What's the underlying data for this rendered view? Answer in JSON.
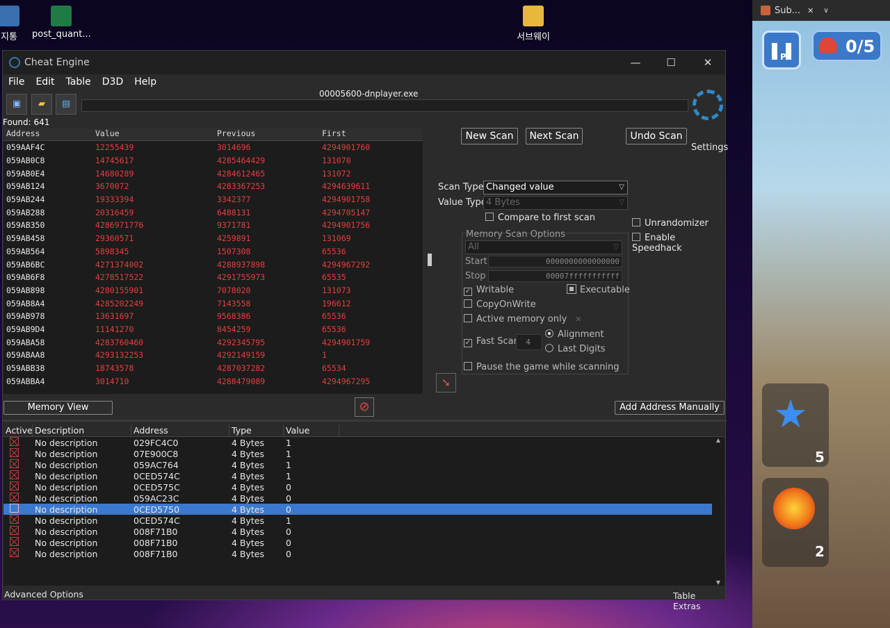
{
  "desktop": {
    "icons": [
      {
        "label": "지통"
      },
      {
        "label": "post_quant..."
      },
      {
        "label": "서브웨이"
      }
    ]
  },
  "window": {
    "title": "Cheat Engine",
    "process_title": "00005600-dnplayer.exe",
    "min": "—",
    "max": "☐",
    "close": "✕"
  },
  "menu": [
    "File",
    "Edit",
    "Table",
    "D3D",
    "Help"
  ],
  "found": "Found: 641",
  "scan_list": {
    "headers": [
      "Address",
      "Value",
      "Previous",
      "First"
    ],
    "rows": [
      [
        "059AAF4C",
        "12255439",
        "3014696",
        "4294901760"
      ],
      [
        "059AB0C8",
        "14745617",
        "4285464429",
        "131070"
      ],
      [
        "059AB0E4",
        "14680289",
        "4284612465",
        "131072"
      ],
      [
        "059AB124",
        "3670072",
        "4283367253",
        "4294639611"
      ],
      [
        "059AB244",
        "19333394",
        "3342377",
        "4294901758"
      ],
      [
        "059AB288",
        "20316459",
        "6488131",
        "4294705147"
      ],
      [
        "059AB350",
        "4286971776",
        "9371781",
        "4294901756"
      ],
      [
        "059AB458",
        "29360571",
        "4259891",
        "131069"
      ],
      [
        "059AB564",
        "5898345",
        "1507308",
        "65536"
      ],
      [
        "059AB6BC",
        "4271374002",
        "4288937898",
        "4294967292"
      ],
      [
        "059AB6F8",
        "4278517522",
        "4291755973",
        "65535"
      ],
      [
        "059AB898",
        "4280155901",
        "7078020",
        "131073"
      ],
      [
        "059AB8A4",
        "4285202249",
        "7143558",
        "196612"
      ],
      [
        "059AB978",
        "13631697",
        "9568386",
        "65536"
      ],
      [
        "059AB9D4",
        "11141270",
        "8454259",
        "65536"
      ],
      [
        "059ABA58",
        "4283760460",
        "4292345795",
        "4294901759"
      ],
      [
        "059ABAA8",
        "4293132253",
        "4292149159",
        "1"
      ],
      [
        "059ABB38",
        "18743578",
        "4287037282",
        "65534"
      ],
      [
        "059ABBA4",
        "3014710",
        "4288479089",
        "4294967295"
      ]
    ]
  },
  "buttons": {
    "new_scan": "New Scan",
    "next_scan": "Next Scan",
    "undo_scan": "Undo Scan",
    "settings": "Settings",
    "memory_view": "Memory View",
    "add_address": "Add Address Manually"
  },
  "scan": {
    "scan_type_label": "Scan Type",
    "scan_type_value": "Changed value",
    "value_type_label": "Value Type",
    "value_type_value": "4 Bytes",
    "compare_first": "Compare to first scan",
    "unrandomizer": "Unrandomizer",
    "speedhack": "Enable Speedhack"
  },
  "memory_opts": {
    "title": "Memory Scan Options",
    "region": "All",
    "start_label": "Start",
    "start_value": "0000000000000000",
    "stop_label": "Stop",
    "stop_value": "00007fffffffffff",
    "writable": "Writable",
    "executable": "Executable",
    "copyonwrite": "CopyOnWrite",
    "active_only": "Active memory only",
    "fast_scan": "Fast Scan",
    "fast_value": "4",
    "alignment": "Alignment",
    "last_digits": "Last Digits",
    "pause": "Pause the game while scanning"
  },
  "address_table": {
    "headers": [
      "Active",
      "Description",
      "Address",
      "Type",
      "Value"
    ],
    "rows": [
      {
        "desc": "No description",
        "addr": "029FC4C0",
        "type": "4 Bytes",
        "value": "1"
      },
      {
        "desc": "No description",
        "addr": "07E900C8",
        "type": "4 Bytes",
        "value": "1"
      },
      {
        "desc": "No description",
        "addr": "059AC764",
        "type": "4 Bytes",
        "value": "1"
      },
      {
        "desc": "No description",
        "addr": "0CED574C",
        "type": "4 Bytes",
        "value": "1"
      },
      {
        "desc": "No description",
        "addr": "0CED575C",
        "type": "4 Bytes",
        "value": "0"
      },
      {
        "desc": "No description",
        "addr": "059AC23C",
        "type": "4 Bytes",
        "value": "0"
      },
      {
        "desc": "No description",
        "addr": "0CED5750",
        "type": "4 Bytes",
        "value": "0"
      },
      {
        "desc": "No description",
        "addr": "0CED574C",
        "type": "4 Bytes",
        "value": "1"
      },
      {
        "desc": "No description",
        "addr": "008F71B0",
        "type": "4 Bytes",
        "value": "0"
      },
      {
        "desc": "No description",
        "addr": "008F71B0",
        "type": "4 Bytes",
        "value": "0"
      },
      {
        "desc": "No description",
        "addr": "008F71B0",
        "type": "4 Bytes",
        "value": "0"
      }
    ],
    "selected_index": 6
  },
  "footer": {
    "advanced": "Advanced Options",
    "extras": "Table Extras"
  },
  "game": {
    "tab_title": "Sub...",
    "tab_close": "✕",
    "counter": "0/5",
    "pause_label": "P",
    "power1_count": "5",
    "power2_count": "2"
  },
  "colors": {
    "value_red": "#e04040",
    "select_blue": "#3b79cf",
    "ce_bg": "#2b2b2b"
  }
}
